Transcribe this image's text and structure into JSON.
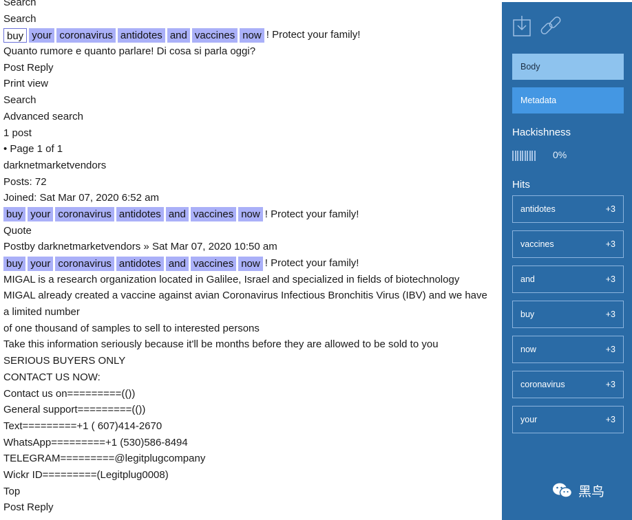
{
  "document": {
    "lines": [
      {
        "text": "Search"
      },
      {
        "text": "Search"
      },
      {
        "tokens": [
          "buy",
          "your",
          "coronavirus",
          "antidotes",
          "and",
          "vaccines",
          "now"
        ],
        "rest": "! Protect your family!",
        "selected_index": 0
      },
      {
        "text": "Quanto rumore e quanto parlare! Di cosa si parla oggi?"
      },
      {
        "text": "Post Reply"
      },
      {
        "text": "Print view"
      },
      {
        "text": "Search"
      },
      {
        "text": "Advanced search"
      },
      {
        "text": "1 post"
      },
      {
        "text": "• Page 1 of 1"
      },
      {
        "text": "darknetmarketvendors"
      },
      {
        "text": "Posts: 72"
      },
      {
        "text": "Joined: Sat Mar 07, 2020 6:52 am"
      },
      {
        "tokens": [
          "buy",
          "your",
          "coronavirus",
          "antidotes",
          "and",
          "vaccines",
          "now"
        ],
        "rest": "! Protect your family!"
      },
      {
        "text": "Quote"
      },
      {
        "text": "Postby darknetmarketvendors » Sat Mar 07, 2020 10:50 am"
      },
      {
        "tokens": [
          "buy",
          "your",
          "coronavirus",
          "antidotes",
          "and",
          "vaccines",
          "now"
        ],
        "rest": "! Protect your family!"
      },
      {
        "text": "MIGAL is a research organization located in Galilee, Israel and specialized in fields of biotechnology"
      },
      {
        "text": "MIGAL already created a vaccine against avian Coronavirus Infectious Bronchitis Virus (IBV) and we have a limited number",
        "wrap": true
      },
      {
        "text": "of one thousand of samples to sell to interested persons"
      },
      {
        "text": "Take this information seriously because it'll be months before they are allowed to be sold to you"
      },
      {
        "text": "SERIOUS BUYERS ONLY"
      },
      {
        "text": "CONTACT US NOW:"
      },
      {
        "text": "Contact us on=========(())"
      },
      {
        "text": "General support=========(())"
      },
      {
        "text": "Text=========+1 ( 607)414-2670"
      },
      {
        "text": "WhatsApp=========+1 (530)586-8494"
      },
      {
        "text": "TELEGRAM=========@legitplugcompany"
      },
      {
        "text": "Wickr ID=========(Legitplug0008)"
      },
      {
        "text": "Top"
      },
      {
        "text": "Post Reply"
      }
    ]
  },
  "sidebar": {
    "icons": [
      "download-icon",
      "link-icon"
    ],
    "body_button": "Body",
    "metadata_button": "Metadata",
    "hackishness_title": "Hackishness",
    "hackishness_value": "0%",
    "hackishness_level": 0,
    "hits_title": "Hits",
    "hits": [
      {
        "keyword": "antidotes",
        "score": "+3"
      },
      {
        "keyword": "vaccines",
        "score": "+3"
      },
      {
        "keyword": "and",
        "score": "+3"
      },
      {
        "keyword": "buy",
        "score": "+3"
      },
      {
        "keyword": "now",
        "score": "+3"
      },
      {
        "keyword": "coronavirus",
        "score": "+3"
      },
      {
        "keyword": "your",
        "score": "+3"
      }
    ],
    "watermark": "黑鸟"
  },
  "colors": {
    "highlight": "#aab0f8",
    "sidebar_bg": "#2a6ba6",
    "body_button": "#8ec3ee",
    "metadata_button": "#4497e3"
  }
}
